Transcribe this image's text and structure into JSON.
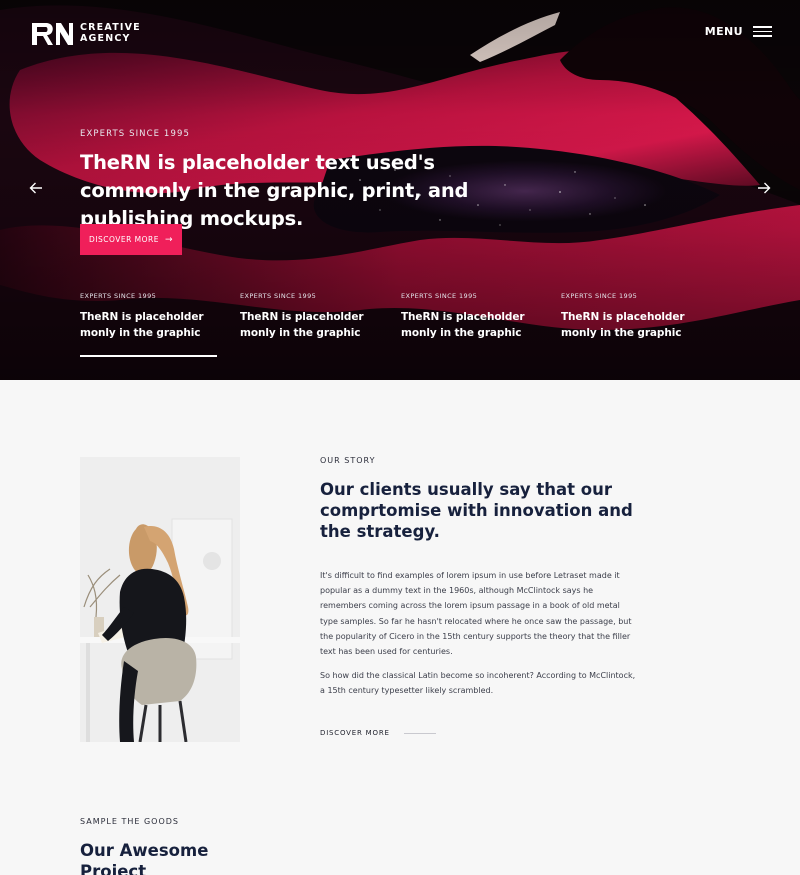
{
  "header": {
    "logo_line1": "CREATIVE",
    "logo_line2": "AGENCY",
    "menu_label": "MENU"
  },
  "hero": {
    "kicker": "EXPERTS SINCE 1995",
    "title": "TheRN is placeholder text used's commonly in the graphic, print, and publishing mockups.",
    "button_label": "DISCOVER MORE",
    "slides": [
      {
        "kicker": "EXPERTS SINCE 1995",
        "title": "TheRN is placeholder monly in the graphic"
      },
      {
        "kicker": "EXPERTS SINCE 1995",
        "title": "TheRN is placeholder monly in the graphic"
      },
      {
        "kicker": "EXPERTS SINCE 1995",
        "title": "TheRN is placeholder monly in the graphic"
      },
      {
        "kicker": "EXPERTS SINCE 1995",
        "title": "TheRN is placeholder monly in the graphic"
      }
    ],
    "active_slide": 1
  },
  "story": {
    "kicker": "OUR STORY",
    "title": "Our clients usually say that our comprtomise with innovation and the strategy.",
    "paragraph1": "It's difficult to find examples of lorem ipsum in use before Letraset made it popular as a dummy text in the 1960s, although McClintock says he remembers coming across the lorem ipsum passage in a book of old metal type samples. So far he hasn't relocated where he once saw the passage, but the popularity of Cicero in the 15th century supports the theory that the filler text has been used for centuries.",
    "paragraph2": "So how did the classical Latin become so incoherent? According to McClintock, a 15th century typesetter likely scrambled.",
    "link_label": "DISCOVER MORE"
  },
  "goods": {
    "kicker": "SAMPLE THE GOODS",
    "title": "Our Awesome Project"
  },
  "colors": {
    "accent": "#f01f5a",
    "heading": "#17213d",
    "page_background": "#f7f7f7",
    "hero_background": "#0b0608"
  },
  "icons": {
    "logo": "rn-logo-icon",
    "menu": "hamburger-icon",
    "prev": "arrow-left-icon",
    "next": "arrow-right-icon",
    "button_arrow": "arrow-right-icon"
  }
}
